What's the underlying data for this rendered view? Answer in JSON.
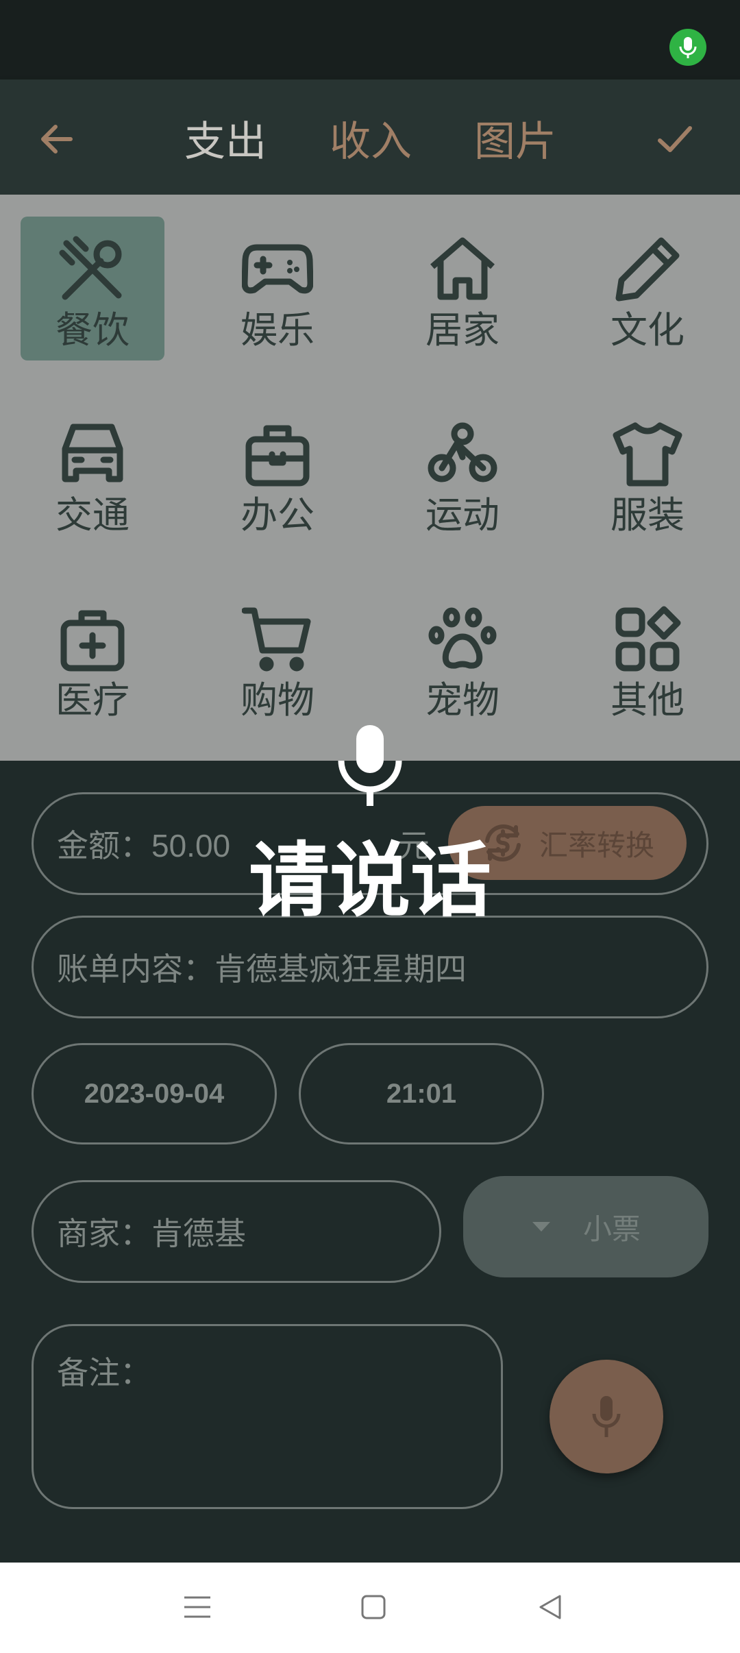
{
  "status_bar": {
    "mic_icon": "mic-icon",
    "mic_color": "#2fb344"
  },
  "app_bar": {
    "back_icon": "arrow-left-icon",
    "tabs": [
      {
        "label": "支出",
        "active": true
      },
      {
        "label": "收入",
        "active": false
      },
      {
        "label": "图片",
        "active": false
      }
    ],
    "confirm_icon": "check-icon",
    "accent_color": "#a07f66"
  },
  "categories": [
    {
      "label": "餐饮",
      "icon": "utensils-icon",
      "selected": true
    },
    {
      "label": "娱乐",
      "icon": "gamepad-icon",
      "selected": false
    },
    {
      "label": "居家",
      "icon": "home-icon",
      "selected": false
    },
    {
      "label": "文化",
      "icon": "pencil-icon",
      "selected": false
    },
    {
      "label": "交通",
      "icon": "car-icon",
      "selected": false
    },
    {
      "label": "办公",
      "icon": "briefcase-icon",
      "selected": false
    },
    {
      "label": "运动",
      "icon": "bike-icon",
      "selected": false
    },
    {
      "label": "服装",
      "icon": "shirt-icon",
      "selected": false
    },
    {
      "label": "医疗",
      "icon": "medical-kit-icon",
      "selected": false
    },
    {
      "label": "购物",
      "icon": "cart-icon",
      "selected": false
    },
    {
      "label": "宠物",
      "icon": "paw-icon",
      "selected": false
    },
    {
      "label": "其他",
      "icon": "grid-icon",
      "selected": false
    }
  ],
  "form": {
    "amount_value": "金额：50.00",
    "amount_unit": "元",
    "exchange_button": "汇率转换",
    "bill_content": "账单内容：肯德基疯狂星期四",
    "date": "2023-09-04",
    "time": "21:01",
    "merchant": "商家：肯德基",
    "receipt_button": "小票",
    "note_label": "备注："
  },
  "voice_overlay": {
    "prompt": "请说话"
  },
  "nav_bar": {
    "recents_icon": "menu-icon",
    "home_icon": "square-icon",
    "back_icon": "triangle-back-icon"
  }
}
